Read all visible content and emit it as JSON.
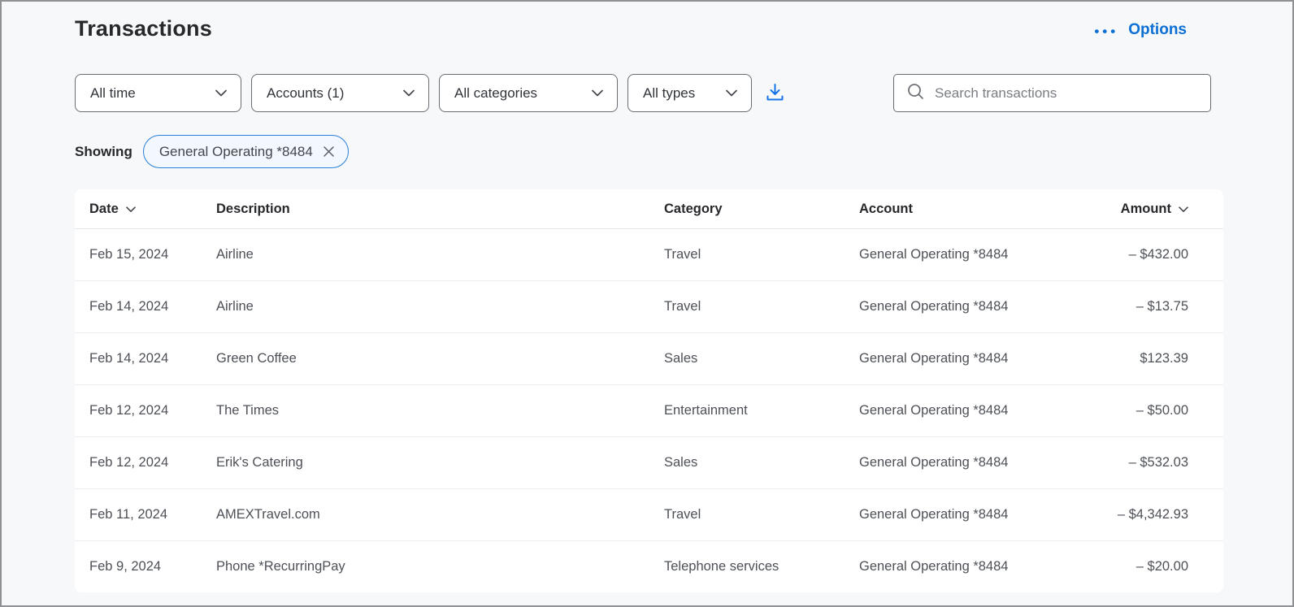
{
  "page": {
    "title": "Transactions",
    "options_label": "Options",
    "options_icon": "•••"
  },
  "filters": {
    "time": "All time",
    "accounts": "Accounts (1)",
    "categories": "All categories",
    "types": "All types"
  },
  "search": {
    "placeholder": "Search transactions"
  },
  "showing": {
    "label": "Showing",
    "chip": "General Operating *8484"
  },
  "table": {
    "columns": [
      {
        "label": "Date",
        "sortable": true
      },
      {
        "label": "Description",
        "sortable": false
      },
      {
        "label": "Category",
        "sortable": false
      },
      {
        "label": "Account",
        "sortable": false
      },
      {
        "label": "Amount",
        "sortable": true
      }
    ],
    "rows": [
      {
        "date": "Feb 15, 2024",
        "description": "Airline",
        "category": "Travel",
        "account": "General Operating *8484",
        "amount": "– $432.00"
      },
      {
        "date": "Feb 14, 2024",
        "description": "Airline",
        "category": "Travel",
        "account": "General Operating *8484",
        "amount": "– $13.75"
      },
      {
        "date": "Feb 14, 2024",
        "description": "Green Coffee",
        "category": "Sales",
        "account": "General Operating *8484",
        "amount": "$123.39"
      },
      {
        "date": "Feb 12, 2024",
        "description": "The Times",
        "category": "Entertainment",
        "account": "General Operating *8484",
        "amount": "– $50.00"
      },
      {
        "date": "Feb 12, 2024",
        "description": "Erik's Catering",
        "category": "Sales",
        "account": "General Operating *8484",
        "amount": "– $532.03"
      },
      {
        "date": "Feb 11, 2024",
        "description": "AMEXTravel.com",
        "category": "Travel",
        "account": "General Operating *8484",
        "amount": "– $4,342.93"
      },
      {
        "date": "Feb 9, 2024",
        "description": "Phone *RecurringPay",
        "category": "Telephone services",
        "account": "General Operating *8484",
        "amount": "– $20.00"
      }
    ]
  },
  "colors": {
    "accent_blue": "#0b6fd3",
    "chip_border": "#2a7fd8",
    "chip_background": "#f3f8fe",
    "page_background": "#f7f8fa",
    "panel_background": "#ffffff",
    "text_primary": "#26282b",
    "text_secondary": "#4d5157"
  }
}
